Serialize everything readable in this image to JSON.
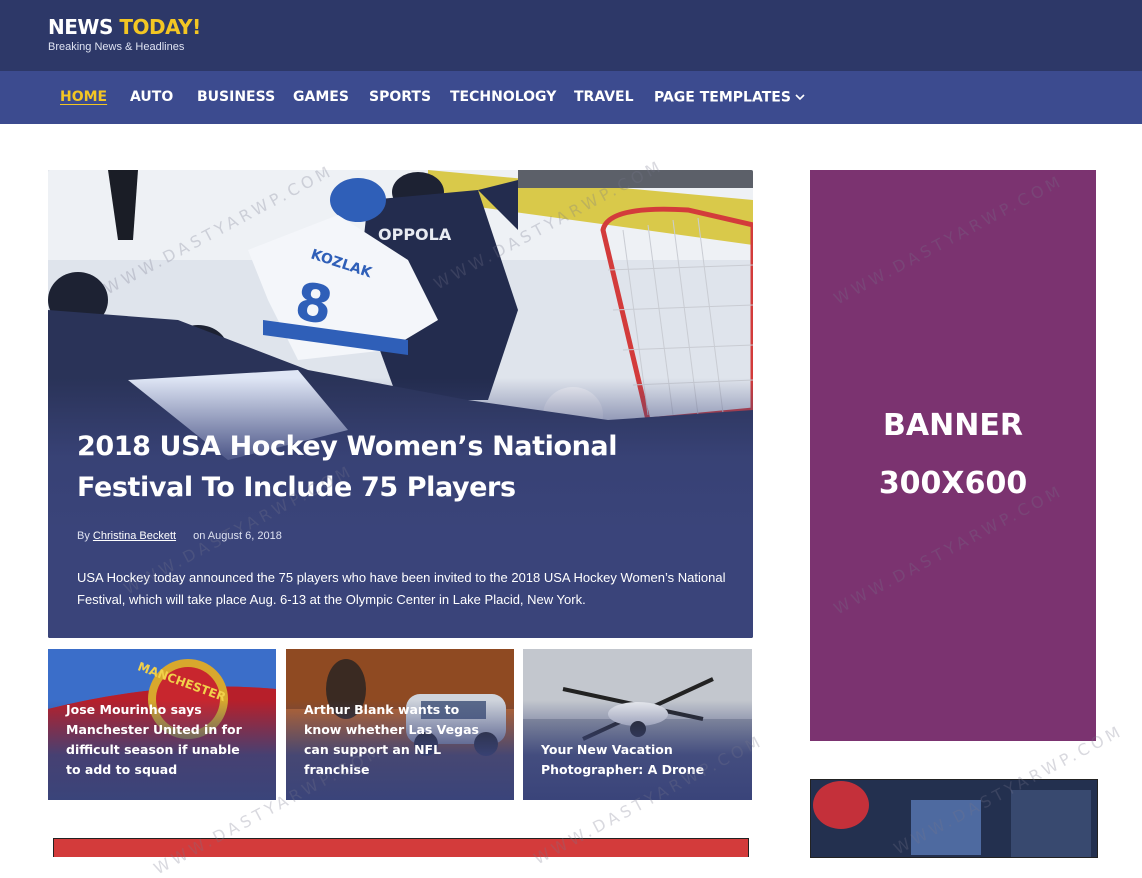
{
  "header": {
    "logo_main": "NEWS ",
    "logo_accent": "TODAY!",
    "tagline": "Breaking News & Headlines"
  },
  "nav": {
    "items": [
      "HOME",
      "AUTO",
      "BUSINESS",
      "GAMES",
      "SPORTS",
      "TECHNOLOGY",
      "TRAVEL",
      "PAGE TEMPLATES"
    ],
    "active": "HOME"
  },
  "hero": {
    "title": "2018 USA Hockey Women’s National Festival To Include 75 Players",
    "by": "By",
    "author": "Christina Beckett",
    "date": "on August 6, 2018",
    "excerpt": "USA Hockey today announced the 75 players who have been invited to the 2018 USA Hockey Women’s National Festival, which will take place Aug. 6-13 at the Olympic Center in Lake Placid, New York.",
    "jersey_name": "KOZLAK",
    "jersey_number": "8",
    "opponent_jersey": "OPPOLA"
  },
  "cards": [
    {
      "title": "Jose Mourinho says Manchester United in for difficult season if unable to add to squad",
      "image_text": "MANCHESTER"
    },
    {
      "title": "Arthur Blank wants to know whether Las Vegas can support an NFL franchise"
    },
    {
      "title": "Your New Vacation Photographer: A Drone"
    }
  ],
  "sidebar": {
    "banner_line1": "BANNER",
    "banner_line2": "300X600"
  },
  "watermark": {
    "text": "WWW.DASTYARWP.COM"
  },
  "colors": {
    "header_bg": "#2d3868",
    "nav_bg": "#3c4b8f",
    "accent": "#f3c623",
    "banner_bg": "#7b3370"
  }
}
